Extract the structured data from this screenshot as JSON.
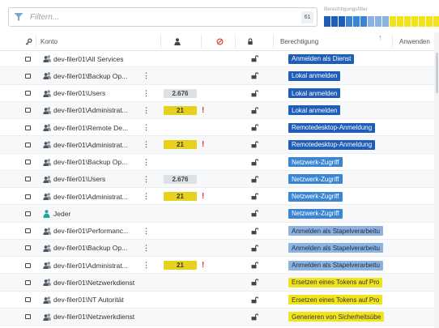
{
  "filter": {
    "placeholder": "Filtern...",
    "count": "61"
  },
  "permission_filter": {
    "label": "Berechtigungsfilter",
    "segments": [
      {
        "color": "#1e5eb8"
      },
      {
        "color": "#1e5eb8"
      },
      {
        "color": "#1e5eb8"
      },
      {
        "color": "#3a86d4"
      },
      {
        "color": "#3a86d4"
      },
      {
        "color": "#3a86d4"
      },
      {
        "color": "#8cb2e0"
      },
      {
        "color": "#8cb2e0"
      },
      {
        "color": "#8cb2e0"
      },
      {
        "color": "#f1e41c"
      },
      {
        "color": "#f1e41c"
      },
      {
        "color": "#f1e41c"
      },
      {
        "color": "#f1e41c"
      },
      {
        "color": "#f1e41c"
      },
      {
        "color": "#f1e41c"
      },
      {
        "color": "#f1e41c"
      }
    ]
  },
  "columns": {
    "owner_icon": "key-icon",
    "konto": "Konto",
    "members_icon": "user-icon",
    "deny_icon": "prohibited-icon",
    "lock_icon": "lock-icon",
    "berechtigung": "Berechtigung",
    "sort_indicator": "↑",
    "anwenden": "Anwenden"
  },
  "colors": {
    "dark_blue": "#1e5eb8",
    "mid_blue": "#3a86d4",
    "light_blue": "#8cb2e0",
    "yellow": "#f1e41c",
    "warning_red": "#e0312f"
  },
  "rows": [
    {
      "account": "dev-filer01\\All Services",
      "icon": "group-icon",
      "menu": "",
      "members": "",
      "members_style": "",
      "warning": "",
      "permission": "Anmelden als Dienst",
      "perm_color": "#1e5eb8",
      "perm_text": "#ffffff"
    },
    {
      "account": "dev-filer01\\Backup Op...",
      "icon": "group-icon",
      "menu": "⋮",
      "members": "",
      "members_style": "",
      "warning": "",
      "permission": "Lokal anmelden",
      "perm_color": "#1e5eb8",
      "perm_text": "#ffffff"
    },
    {
      "account": "dev-filer01\\Users",
      "icon": "group-icon",
      "menu": "⋮",
      "members": "2.676",
      "members_style": "grey",
      "warning": "",
      "permission": "Lokal anmelden",
      "perm_color": "#1e5eb8",
      "perm_text": "#ffffff"
    },
    {
      "account": "dev-filer01\\Administrat...",
      "icon": "group-icon",
      "menu": "⋮",
      "members": "21",
      "members_style": "yellow",
      "warning": "!",
      "permission": "Lokal anmelden",
      "perm_color": "#1e5eb8",
      "perm_text": "#ffffff"
    },
    {
      "account": "dev-filer01\\Remote De...",
      "icon": "group-icon",
      "menu": "⋮",
      "members": "",
      "members_style": "",
      "warning": "",
      "permission": "Remotedesktop-Anmeldung",
      "perm_color": "#1e5eb8",
      "perm_text": "#ffffff"
    },
    {
      "account": "dev-filer01\\Administrat...",
      "icon": "group-icon",
      "menu": "⋮",
      "members": "21",
      "members_style": "yellow",
      "warning": "!",
      "permission": "Remotedesktop-Anmeldung",
      "perm_color": "#1e5eb8",
      "perm_text": "#ffffff"
    },
    {
      "account": "dev-filer01\\Backup Op...",
      "icon": "group-icon",
      "menu": "⋮",
      "members": "",
      "members_style": "",
      "warning": "",
      "permission": "Netzwerk-Zugriff",
      "perm_color": "#3a86d4",
      "perm_text": "#ffffff"
    },
    {
      "account": "dev-filer01\\Users",
      "icon": "group-icon",
      "menu": "⋮",
      "members": "2.676",
      "members_style": "grey",
      "warning": "",
      "permission": "Netzwerk-Zugriff",
      "perm_color": "#3a86d4",
      "perm_text": "#ffffff"
    },
    {
      "account": "dev-filer01\\Administrat...",
      "icon": "group-icon",
      "menu": "⋮",
      "members": "21",
      "members_style": "yellow",
      "warning": "!",
      "permission": "Netzwerk-Zugriff",
      "perm_color": "#3a86d4",
      "perm_text": "#ffffff"
    },
    {
      "account": "Jeder",
      "icon": "person-icon",
      "menu": "",
      "members": "",
      "members_style": "",
      "warning": "",
      "permission": "Netzwerk-Zugriff",
      "perm_color": "#3a86d4",
      "perm_text": "#ffffff"
    },
    {
      "account": "dev-filer01\\Performanc...",
      "icon": "group-icon",
      "menu": "⋮",
      "members": "",
      "members_style": "",
      "warning": "",
      "permission": "Anmelden als Stapelverarbeitu",
      "perm_color": "#8cb2e0",
      "perm_text": "#1d2b3a"
    },
    {
      "account": "dev-filer01\\Backup Op...",
      "icon": "group-icon",
      "menu": "⋮",
      "members": "",
      "members_style": "",
      "warning": "",
      "permission": "Anmelden als Stapelverarbeitu",
      "perm_color": "#8cb2e0",
      "perm_text": "#1d2b3a"
    },
    {
      "account": "dev-filer01\\Administrat...",
      "icon": "group-icon",
      "menu": "⋮",
      "members": "21",
      "members_style": "yellow",
      "warning": "!",
      "permission": "Anmelden als Stapelverarbeitu",
      "perm_color": "#8cb2e0",
      "perm_text": "#1d2b3a"
    },
    {
      "account": "dev-filer01\\Netzwerkdienst",
      "icon": "group-icon",
      "menu": "",
      "members": "",
      "members_style": "",
      "warning": "",
      "permission": "Ersetzen eines Tokens auf Pro",
      "perm_color": "#f1e41c",
      "perm_text": "#333333"
    },
    {
      "account": "dev-filer01\\NT Autorität",
      "icon": "group-icon",
      "menu": "",
      "members": "",
      "members_style": "",
      "warning": "",
      "permission": "Ersetzen eines Tokens auf Pro",
      "perm_color": "#f1e41c",
      "perm_text": "#333333"
    },
    {
      "account": "dev-filer01\\Netzwerkdienst",
      "icon": "group-icon",
      "menu": "",
      "members": "",
      "members_style": "",
      "warning": "",
      "permission": "Generieren von Sicherheitsübe",
      "perm_color": "#f1e41c",
      "perm_text": "#333333"
    }
  ]
}
